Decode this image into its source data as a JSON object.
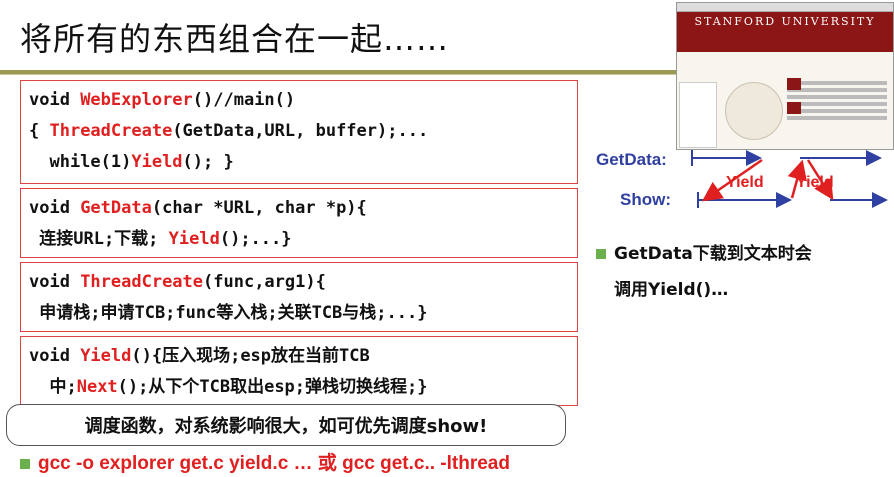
{
  "title": "将所有的东西组合在一起……",
  "code_blocks": [
    {
      "lines": [
        [
          {
            "t": "void "
          },
          {
            "t": "WebExplorer",
            "red": true
          },
          {
            "t": "()//main()"
          }
        ],
        [
          {
            "t": "{ "
          },
          {
            "t": "ThreadCreate",
            "red": true
          },
          {
            "t": "(GetData,URL, buffer);..."
          }
        ],
        [
          {
            "t": "  while(1)"
          },
          {
            "t": "Yield",
            "red": true
          },
          {
            "t": "(); }"
          }
        ]
      ]
    },
    {
      "lines": [
        [
          {
            "t": "void "
          },
          {
            "t": "GetData",
            "red": true
          },
          {
            "t": "(char *URL, char *p){"
          }
        ],
        [
          {
            "t": " 连接URL;下载; "
          },
          {
            "t": "Yield",
            "red": true
          },
          {
            "t": "();...}"
          }
        ]
      ]
    },
    {
      "lines": [
        [
          {
            "t": "void "
          },
          {
            "t": "ThreadCreate",
            "red": true
          },
          {
            "t": "(func,arg1){"
          }
        ],
        [
          {
            "t": " 申请栈;申请TCB;func等入栈;关联TCB与栈;...}"
          }
        ]
      ]
    },
    {
      "lines": [
        [
          {
            "t": "void "
          },
          {
            "t": "Yield",
            "red": true
          },
          {
            "t": "(){压入现场;esp放在当前TCB"
          }
        ],
        [
          {
            "t": "  中;"
          },
          {
            "t": "Next",
            "red": true
          },
          {
            "t": "();从下个TCB取出esp;弹栈切换线程;}"
          }
        ]
      ]
    }
  ],
  "note": "调度函数，对系统影响很大，如可优先调度show!",
  "gcc_line": "gcc -o explorer get.c yield.c … 或 gcc get.c.. -lthread",
  "screenshot": {
    "banner": "STANFORD UNIVERSITY"
  },
  "diagram": {
    "getdata_label": "GetData:",
    "show_label": "Show:",
    "yield1": "Yield",
    "yield2": "Yield"
  },
  "side_note": {
    "line1": "GetData下载到文本时会",
    "line2": "调用Yield()…"
  },
  "colors": {
    "accent_red": "#e02020",
    "label_blue": "#3040a0",
    "bullet_green": "#6ab04c",
    "stanford_red": "#8c1515"
  }
}
